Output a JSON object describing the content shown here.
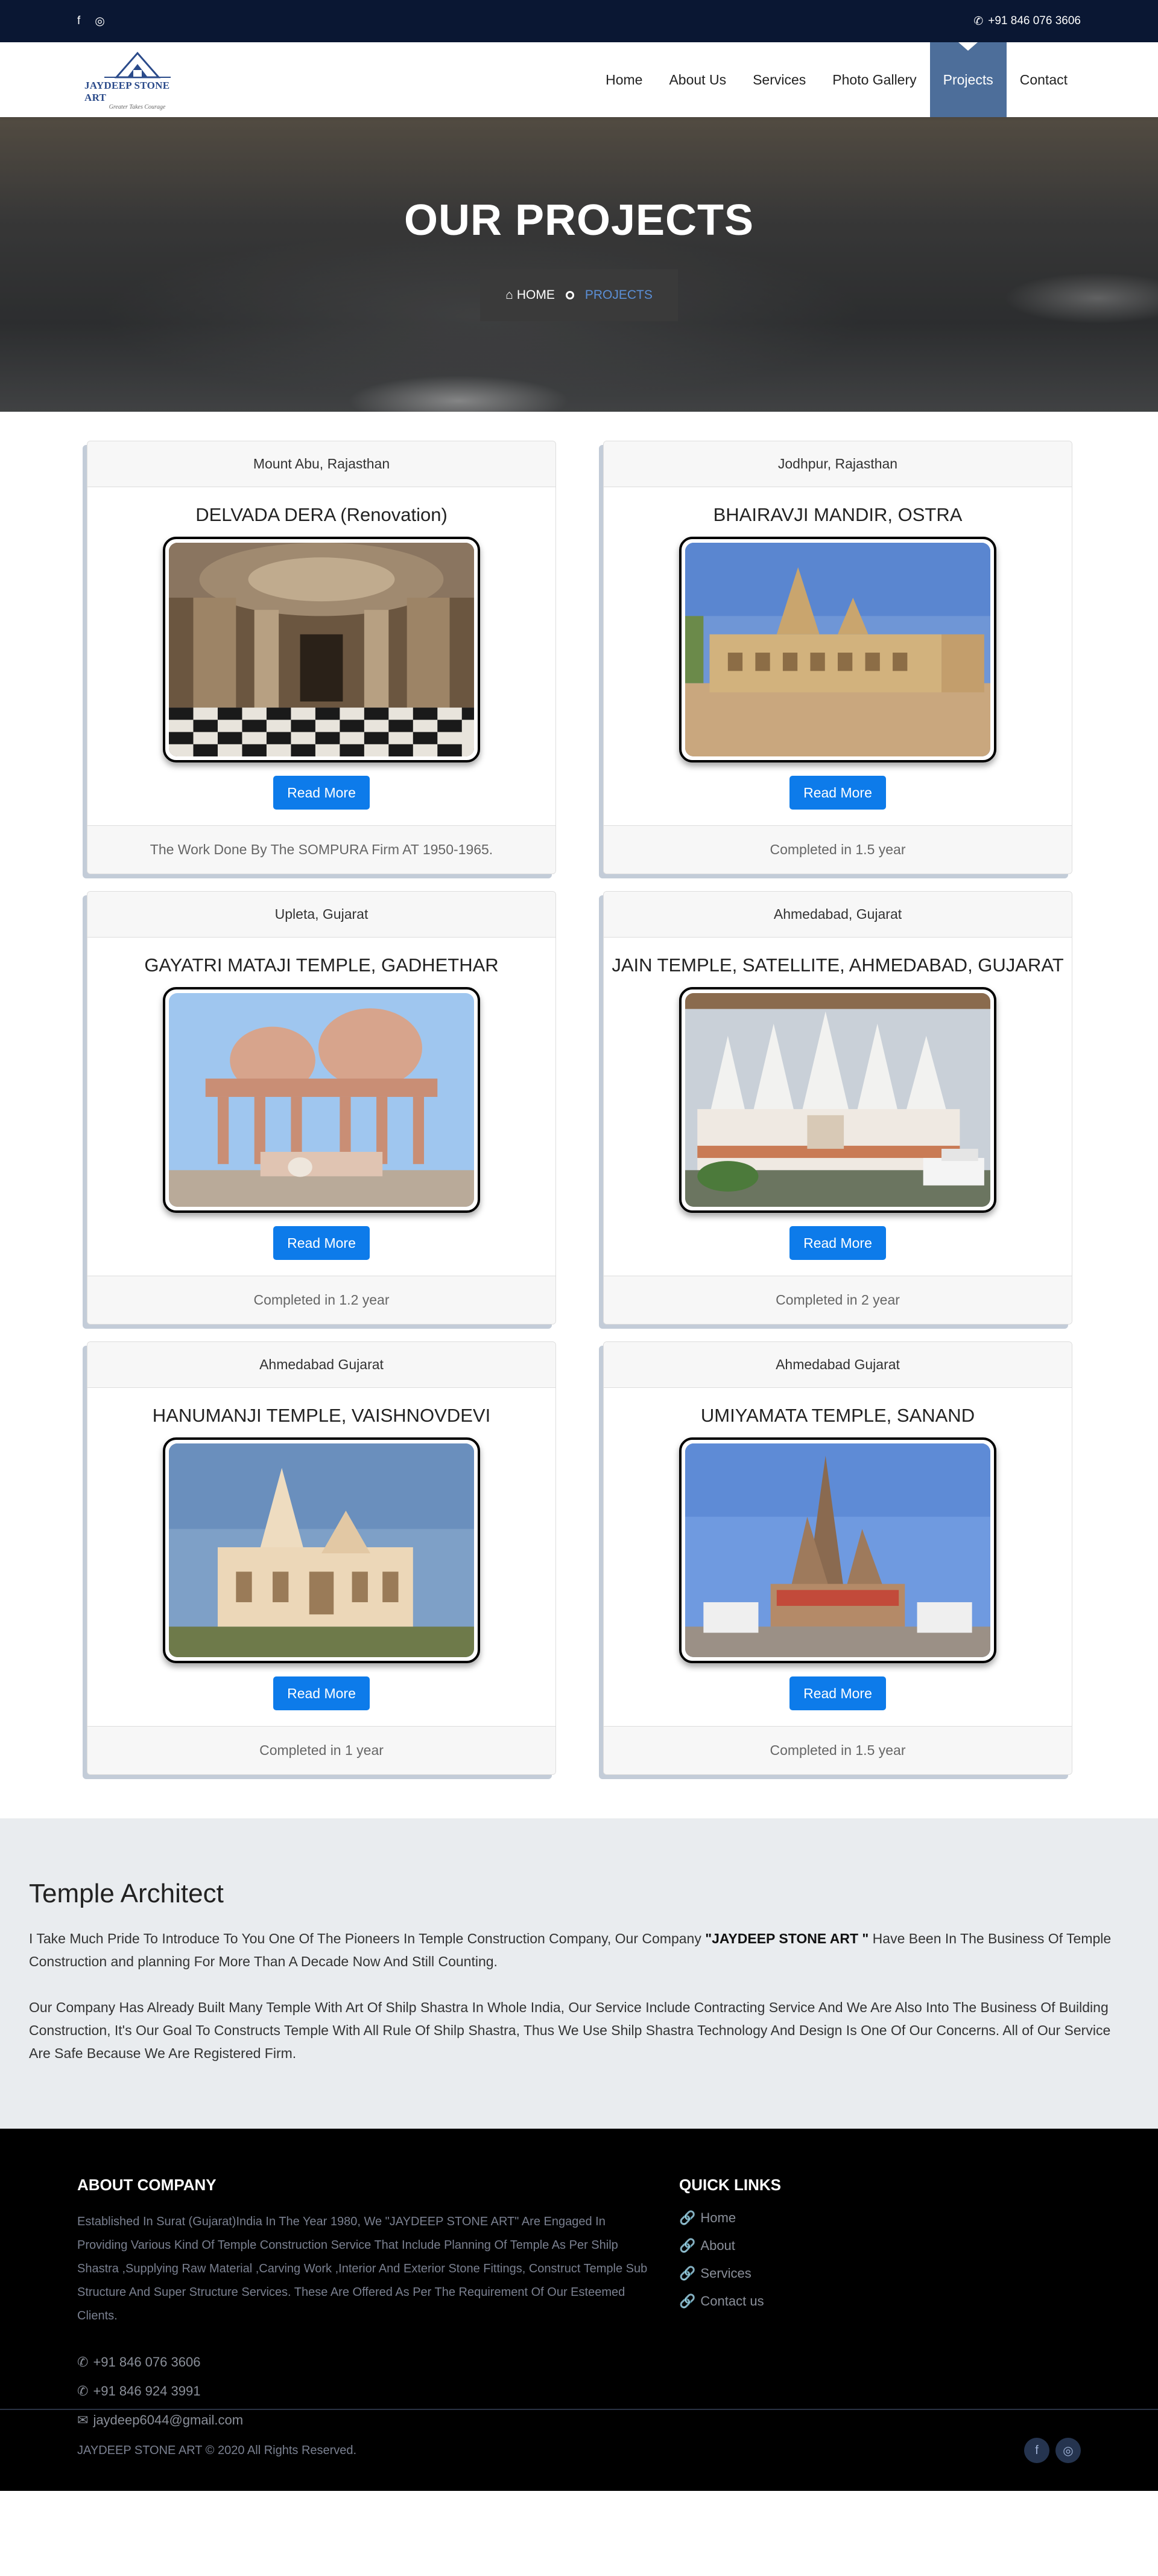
{
  "topbar": {
    "facebook_icon": "f",
    "instagram_icon": "◎",
    "phone_icon": "✆",
    "phone": "+91 846 076 3606"
  },
  "logo": {
    "brand": "JAYDEEP STONE ART",
    "tagline": "Greater Takes Courage"
  },
  "nav": {
    "items": [
      "Home",
      "About Us",
      "Services",
      "Photo Gallery",
      "Projects",
      "Contact"
    ],
    "active": "Projects",
    "active_color": "#4d6e9a"
  },
  "hero": {
    "title": "OUR PROJECTS",
    "breadcrumb_home": "HOME",
    "breadcrumb_current": "PROJECTS"
  },
  "projects": [
    {
      "location": "Mount Abu, Rajasthan",
      "title": "DELVADA DERA (Renovation)",
      "button": "Read More",
      "footer": "The Work Done By The SOMPURA Firm AT 1950-1965."
    },
    {
      "location": "Jodhpur, Rajasthan",
      "title": "BHAIRAVJI MANDIR, OSTRA",
      "button": "Read More",
      "footer": "Completed in 1.5 year"
    },
    {
      "location": "Upleta, Gujarat",
      "title": "GAYATRI MATAJI TEMPLE, GADHETHAR",
      "button": "Read More",
      "footer": "Completed in 1.2 year"
    },
    {
      "location": "Ahmedabad, Gujarat",
      "title": "JAIN TEMPLE, SATELLITE, AHMEDABAD, GUJARAT",
      "button": "Read More",
      "footer": "Completed in 2 year"
    },
    {
      "location": "Ahmedabad Gujarat",
      "title": "HANUMANJI TEMPLE, VAISHNOVDEVI",
      "button": "Read More",
      "footer": "Completed in 1 year"
    },
    {
      "location": "Ahmedabad Gujarat",
      "title": "UMIYAMATA TEMPLE, SANAND",
      "button": "Read More",
      "footer": "Completed in 1.5 year"
    }
  ],
  "about": {
    "heading": "Temple Architect",
    "p1_before": "I Take Much Pride To Introduce To You One Of The Pioneers In Temple Construction Company, Our Company ",
    "p1_bold": "\"JAYDEEP STONE ART \"",
    "p1_after": " Have Been In The Business Of Temple Construction and planning For More Than A Decade Now And Still Counting.",
    "p2": "Our Company Has Already Built Many Temple With Art Of Shilp Shastra In Whole India, Our Service Include Contracting Service And We Are Also Into The Business Of Building Construction, It's Our Goal To Constructs Temple With All Rule Of Shilp Shastra, Thus We Use Shilp Shastra Technology And Design Is One Of Our Concerns. All of Our Service Are Safe Because We Are Registered Firm."
  },
  "footer": {
    "about_heading": "ABOUT COMPANY",
    "about_text": "Established In Surat (Gujarat)India In The Year 1980, We \"JAYDEEP STONE ART\" Are Engaged In Providing Various Kind Of Temple Construction Service That Include Planning Of Temple As Per Shilp Shastra ,Supplying Raw Material ,Carving Work ,Interior And Exterior Stone Fittings, Construct Temple Sub Structure And Super Structure Services. These Are Offered As Per The Requirement Of Our Esteemed Clients.",
    "phone_icon": "✆",
    "phone1": "+91 846 076 3606",
    "phone2": "+91 846 924 3991",
    "email_icon": "✉",
    "email": "jaydeep6044@gmail.com",
    "links_heading": "QUICK LINKS",
    "link_icon": "🔗",
    "links": [
      "Home",
      "About",
      "Services",
      "Contact us"
    ],
    "copyright": "JAYDEEP STONE ART © 2020 All Rights Reserved.",
    "social_facebook": "f",
    "social_instagram": "◎"
  }
}
